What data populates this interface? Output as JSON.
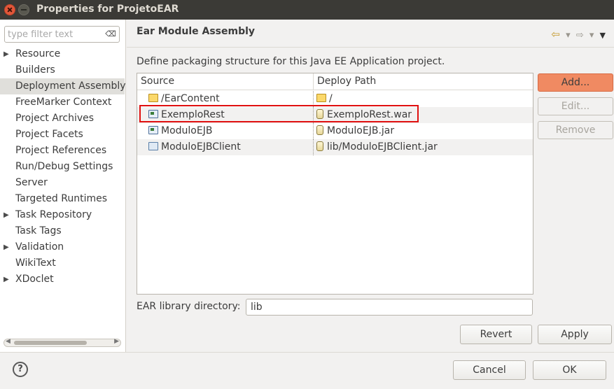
{
  "window": {
    "title": "Properties for ProjetoEAR"
  },
  "filter": {
    "placeholder": "type filter text",
    "value": ""
  },
  "nav": {
    "items": [
      {
        "label": "Resource",
        "expandable": true,
        "selected": false
      },
      {
        "label": "Builders",
        "expandable": false,
        "selected": false
      },
      {
        "label": "Deployment Assembly",
        "expandable": false,
        "selected": true
      },
      {
        "label": "FreeMarker Context",
        "expandable": false,
        "selected": false
      },
      {
        "label": "Project Archives",
        "expandable": false,
        "selected": false
      },
      {
        "label": "Project Facets",
        "expandable": false,
        "selected": false
      },
      {
        "label": "Project References",
        "expandable": false,
        "selected": false
      },
      {
        "label": "Run/Debug Settings",
        "expandable": false,
        "selected": false
      },
      {
        "label": "Server",
        "expandable": false,
        "selected": false
      },
      {
        "label": "Targeted Runtimes",
        "expandable": false,
        "selected": false
      },
      {
        "label": "Task Repository",
        "expandable": true,
        "selected": false
      },
      {
        "label": "Task Tags",
        "expandable": false,
        "selected": false
      },
      {
        "label": "Validation",
        "expandable": true,
        "selected": false
      },
      {
        "label": "WikiText",
        "expandable": false,
        "selected": false
      },
      {
        "label": "XDoclet",
        "expandable": true,
        "selected": false
      }
    ]
  },
  "page": {
    "title": "Ear Module Assembly",
    "description": "Define packaging structure for this Java EE Application project."
  },
  "table": {
    "headers": {
      "source": "Source",
      "deploy": "Deploy Path"
    },
    "rows": [
      {
        "source": "/EarContent",
        "deploy": "/",
        "source_icon": "folder-icon",
        "deploy_icon": "folder-icon"
      },
      {
        "source": "ExemploRest",
        "deploy": "ExemploRest.war",
        "source_icon": "web-project-icon",
        "deploy_icon": "jar-icon"
      },
      {
        "source": "ModuloEJB",
        "deploy": "ModuloEJB.jar",
        "source_icon": "ejb-project-icon",
        "deploy_icon": "jar-icon"
      },
      {
        "source": "ModuloEJBClient",
        "deploy": "lib/ModuloEJBClient.jar",
        "source_icon": "open-folder-icon",
        "deploy_icon": "jar-icon"
      }
    ]
  },
  "buttons": {
    "add": "Add...",
    "edit": "Edit...",
    "remove": "Remove",
    "revert": "Revert",
    "apply": "Apply",
    "cancel": "Cancel",
    "ok": "OK"
  },
  "ear_library": {
    "label": "EAR library directory:",
    "value": "lib"
  },
  "colors": {
    "accent": "#f08a62",
    "highlight": "#e01010",
    "titlebar": "#3b3a36",
    "selection": "#e0dfdb"
  }
}
